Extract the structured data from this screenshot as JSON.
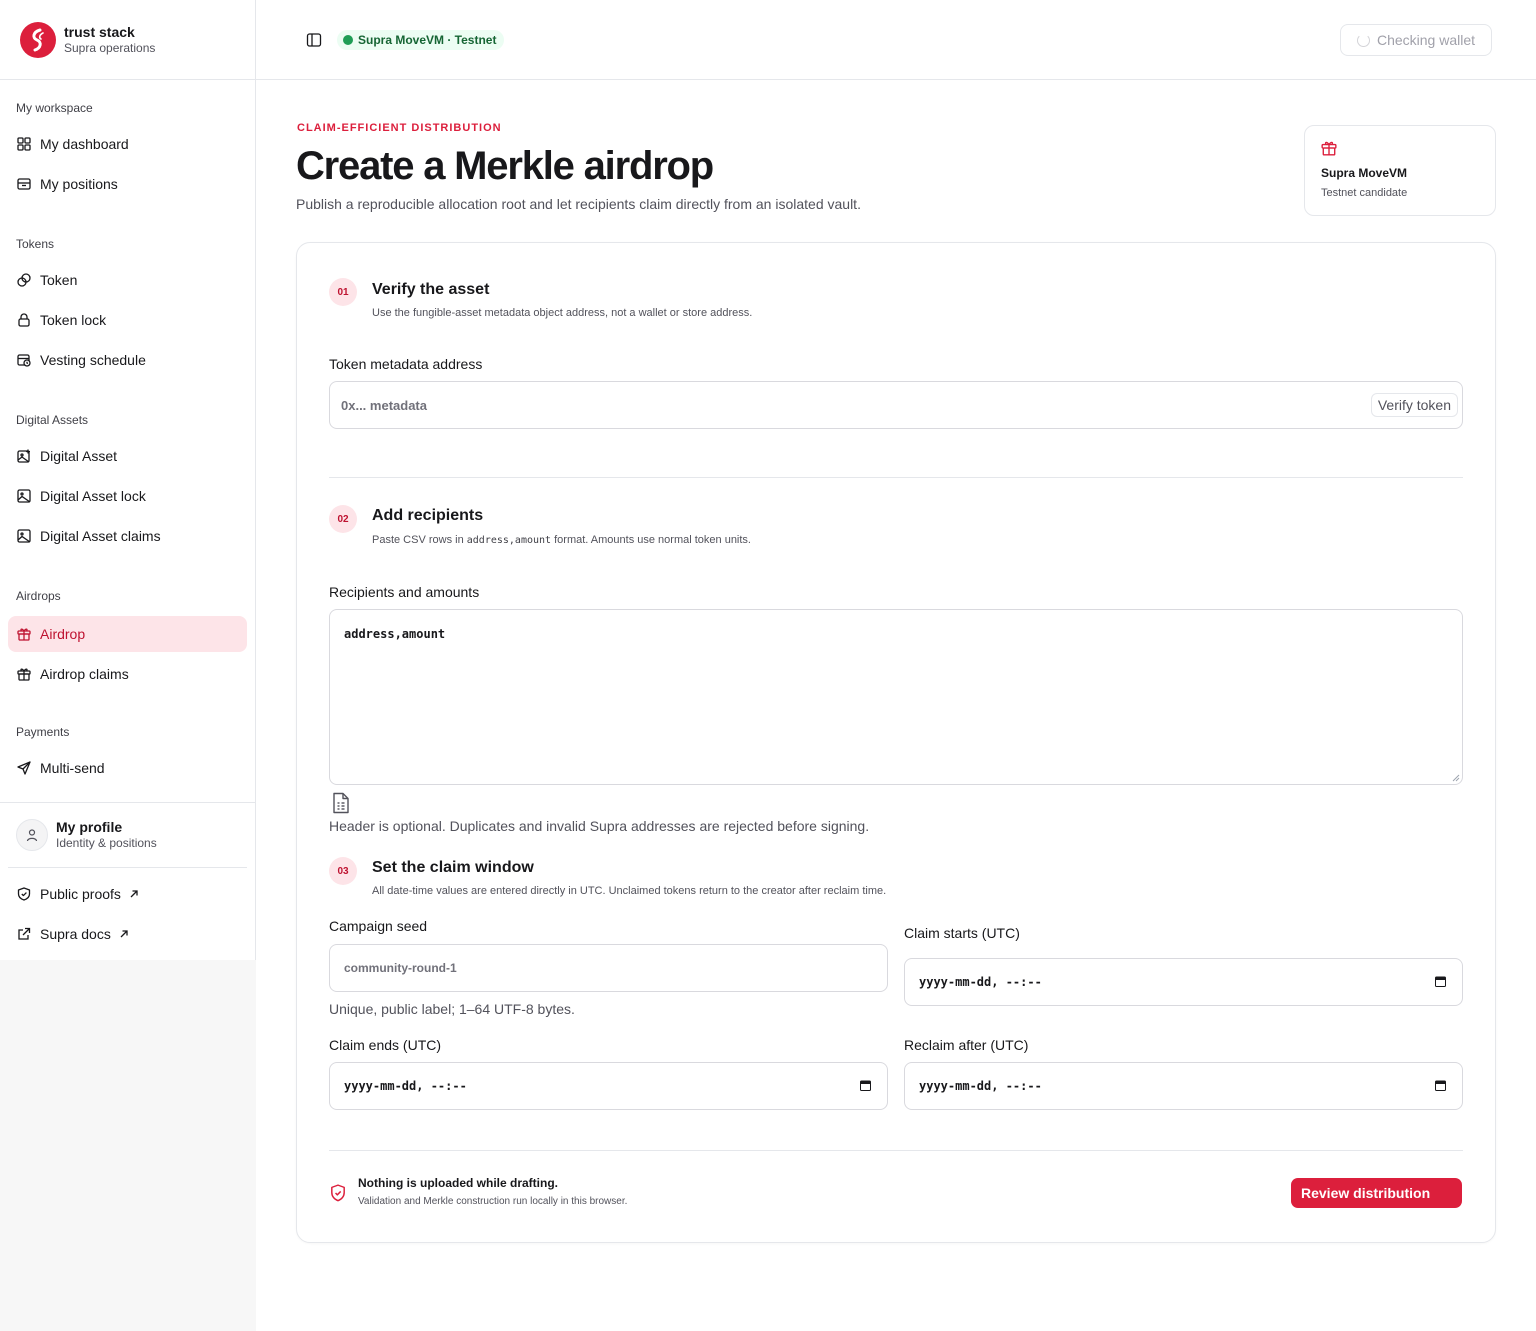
{
  "brand": {
    "name": "trust stack",
    "subtitle": "Supra operations"
  },
  "sidebar": {
    "sections": [
      {
        "heading": "My workspace",
        "items": [
          {
            "label": "My dashboard",
            "icon": "dashboard-grid-icon"
          },
          {
            "label": "My positions",
            "icon": "archive-box-icon"
          }
        ]
      },
      {
        "heading": "Tokens",
        "items": [
          {
            "label": "Token",
            "icon": "coins-icon"
          },
          {
            "label": "Token lock",
            "icon": "lock-icon"
          },
          {
            "label": "Vesting schedule",
            "icon": "calendar-clock-icon"
          }
        ]
      },
      {
        "heading": "Digital Assets",
        "items": [
          {
            "label": "Digital Asset",
            "icon": "image-plus-icon"
          },
          {
            "label": "Digital Asset lock",
            "icon": "image-icon"
          },
          {
            "label": "Digital Asset claims",
            "icon": "image-icon"
          }
        ]
      },
      {
        "heading": "Airdrops",
        "items": [
          {
            "label": "Airdrop",
            "icon": "gift-icon",
            "active": true
          },
          {
            "label": "Airdrop claims",
            "icon": "gift-icon"
          }
        ]
      },
      {
        "heading": "Payments",
        "items": [
          {
            "label": "Multi-send",
            "icon": "send-icon"
          }
        ]
      }
    ],
    "profile": {
      "name": "My profile",
      "subtitle": "Identity & positions"
    },
    "links": [
      {
        "label": "Public proofs",
        "icon": "shield-check-icon"
      },
      {
        "label": "Supra docs",
        "icon": "external-link-icon"
      }
    ]
  },
  "topbar": {
    "network": "Supra MoveVM · Testnet",
    "wallet_status": "Checking wallet"
  },
  "header": {
    "eyebrow": "CLAIM-EFFICIENT DISTRIBUTION",
    "title": "Create a Merkle airdrop",
    "subtitle": "Publish a reproducible allocation root and let recipients claim directly from an isolated vault.",
    "chain_card": {
      "name": "Supra MoveVM",
      "status": "Testnet candidate"
    }
  },
  "steps": {
    "s1": {
      "num": "01",
      "title": "Verify the asset",
      "desc": "Use the fungible-asset metadata object address, not a wallet or store address.",
      "field_label": "Token metadata address",
      "placeholder": "0x... metadata",
      "button": "Verify token"
    },
    "s2": {
      "num": "02",
      "title": "Add recipients",
      "desc_a": "Paste CSV rows in ",
      "desc_code": "address,amount",
      "desc_b": " format. Amounts use normal token units.",
      "field_label": "Recipients and amounts",
      "value": "address,amount",
      "help": "Header is optional. Duplicates and invalid Supra addresses are rejected before signing."
    },
    "s3": {
      "num": "03",
      "title": "Set the claim window",
      "desc": "All date-time values are entered directly in UTC. Unclaimed tokens return to the creator after reclaim time.",
      "seed_label": "Campaign seed",
      "seed_placeholder": "community-round-1",
      "seed_help": "Unique, public label; 1–64 UTF-8 bytes.",
      "starts_label": "Claim starts (UTC)",
      "ends_label": "Claim ends (UTC)",
      "reclaim_label": "Reclaim after (UTC)",
      "date_placeholder": "yyyy-mm-dd, --:--"
    }
  },
  "footer": {
    "note_title": "Nothing is uploaded while drafting.",
    "note_sub": "Validation and Merkle construction run locally in this browser.",
    "review_button": "Review distribution"
  },
  "colors": {
    "accent": "#dc1f3c",
    "accent_soft": "#fde4e8",
    "success": "#1f9d55"
  }
}
